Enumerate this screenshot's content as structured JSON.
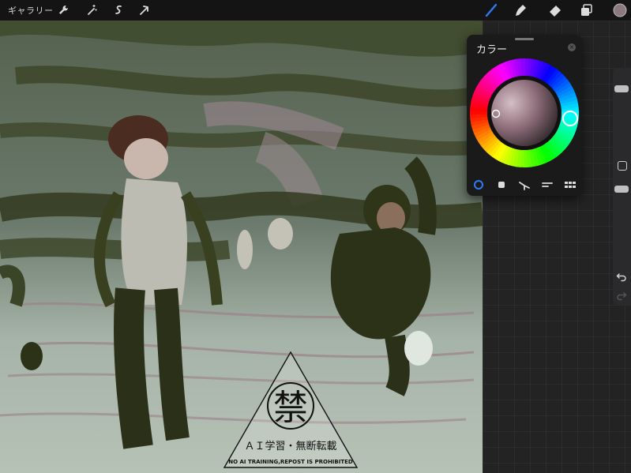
{
  "topbar": {
    "gallery_label": "ギャラリー",
    "left_tools": [
      "wrench-icon",
      "magic-wand-icon",
      "selection-icon",
      "transform-arrow-icon"
    ],
    "right_tools": [
      "brush-icon",
      "smudge-icon",
      "eraser-icon",
      "layers-icon",
      "color-swatch"
    ],
    "active_tool": "brush-icon",
    "accent_color": "#2f7bf5",
    "current_color": "#8a7a80"
  },
  "color_panel": {
    "title": "カラー",
    "close_glyph": "×",
    "modes": [
      "disc-mode-icon",
      "classic-mode-icon",
      "harmony-mode-icon",
      "value-mode-icon",
      "palettes-mode-icon"
    ],
    "active_mode": "disc-mode-icon"
  },
  "watermark": {
    "kanji": "禁",
    "line1": "ＡＩ学習・無断転載",
    "line2": "NO AI TRAINING,REPOST IS PROHIBITED"
  },
  "sidebar": {
    "brush_size_level": 0.1,
    "opacity_level": 0.15
  }
}
